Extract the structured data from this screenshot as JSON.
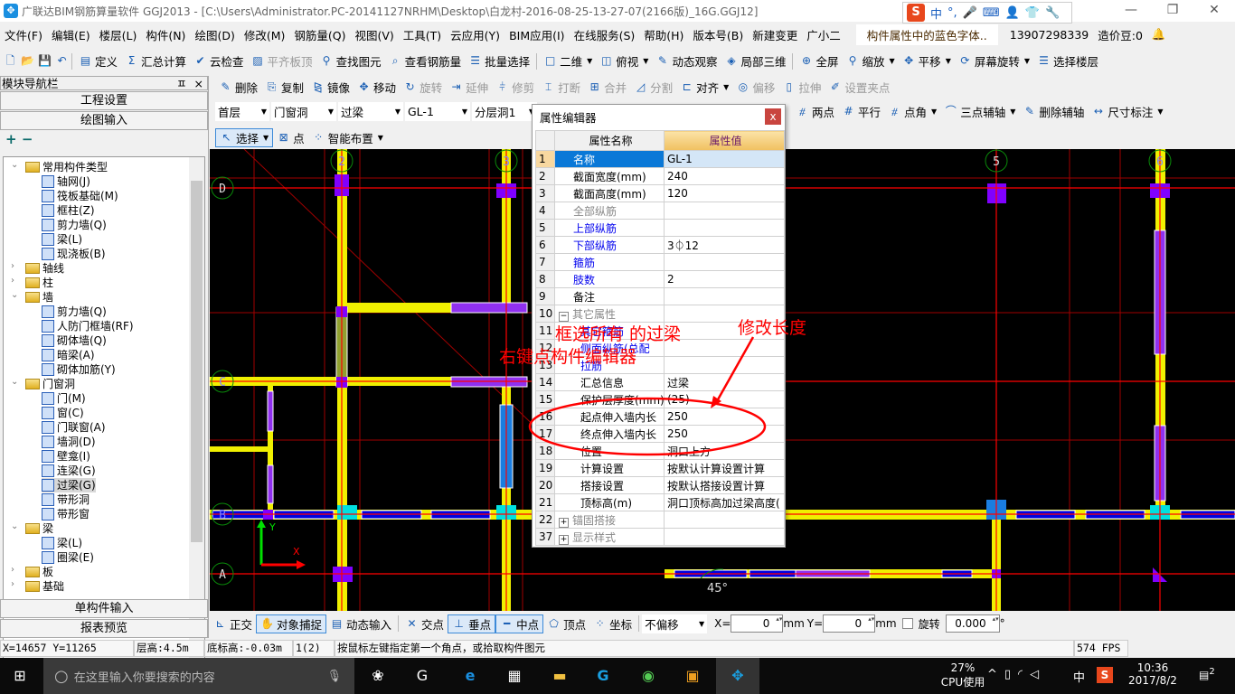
{
  "window": {
    "title": "广联达BIM钢筋算量软件 GGJ2013 - [C:\\Users\\Administrator.PC-20141127NRHM\\Desktop\\白龙村-2016-08-25-13-27-07(2166版)_16G.GGJ12]",
    "minimize": "—",
    "restore": "❐",
    "close": "✕"
  },
  "ime": {
    "items": [
      "S",
      "中",
      "°,",
      "🎤",
      "⌨",
      "👤",
      "👕",
      "🔧"
    ]
  },
  "menubar": {
    "items": [
      "文件(F)",
      "编辑(E)",
      "楼层(L)",
      "构件(N)",
      "绘图(D)",
      "修改(M)",
      "钢筋量(Q)",
      "视图(V)",
      "工具(T)",
      "云应用(Y)",
      "BIM应用(I)",
      "在线服务(S)",
      "帮助(H)",
      "版本号(B)",
      "新建变更",
      "广小二"
    ],
    "notice": "构件属性中的蓝色字体..",
    "account": "13907298339",
    "beans": "造价豆:0"
  },
  "toolbar1": {
    "items": [
      "定义",
      "汇总计算",
      "云检查",
      "平齐板顶",
      "查找图元",
      "查看钢筋量",
      "批量选择",
      "二维",
      "俯视",
      "动态观察",
      "局部三维",
      "全屏",
      "缩放",
      "平移",
      "屏幕旋转",
      "选择楼层"
    ]
  },
  "toolbar2": {
    "items": [
      "删除",
      "复制",
      "镜像",
      "移动",
      "旋转",
      "延伸",
      "修剪",
      "打断",
      "合并",
      "分割",
      "对齐",
      "偏移",
      "拉伸",
      "设置夹点"
    ]
  },
  "selectors": {
    "floor": "首层",
    "category": "门窗洞",
    "type": "过梁",
    "component": "GL-1",
    "layer": "分层洞1"
  },
  "toolbar3": {
    "items": [
      "两点",
      "平行",
      "点角",
      "三点辅轴",
      "删除辅轴",
      "尺寸标注"
    ]
  },
  "toolbar4": {
    "items": [
      "选择",
      "点",
      "智能布置"
    ]
  },
  "sidebar": {
    "title": "模块导航栏",
    "pin": "ㅍ",
    "close": "×",
    "sections": [
      "工程设置",
      "绘图输入",
      "单构件输入",
      "报表预览"
    ],
    "expand_all": "+",
    "collapse_all": "−",
    "tree": [
      {
        "label": "常用构件类型",
        "level": 0,
        "expanded": true
      },
      {
        "label": "轴网(J)",
        "level": 1
      },
      {
        "label": "筏板基础(M)",
        "level": 1
      },
      {
        "label": "框柱(Z)",
        "level": 1
      },
      {
        "label": "剪力墙(Q)",
        "level": 1
      },
      {
        "label": "梁(L)",
        "level": 1
      },
      {
        "label": "现浇板(B)",
        "level": 1
      },
      {
        "label": "轴线",
        "level": 0,
        "expanded": false
      },
      {
        "label": "柱",
        "level": 0,
        "expanded": false
      },
      {
        "label": "墙",
        "level": 0,
        "expanded": true
      },
      {
        "label": "剪力墙(Q)",
        "level": 1
      },
      {
        "label": "人防门框墙(RF)",
        "level": 1
      },
      {
        "label": "砌体墙(Q)",
        "level": 1
      },
      {
        "label": "暗梁(A)",
        "level": 1
      },
      {
        "label": "砌体加筋(Y)",
        "level": 1
      },
      {
        "label": "门窗洞",
        "level": 0,
        "expanded": true
      },
      {
        "label": "门(M)",
        "level": 1
      },
      {
        "label": "窗(C)",
        "level": 1
      },
      {
        "label": "门联窗(A)",
        "level": 1
      },
      {
        "label": "墙洞(D)",
        "level": 1
      },
      {
        "label": "壁龛(I)",
        "level": 1
      },
      {
        "label": "连梁(G)",
        "level": 1
      },
      {
        "label": "过梁(G)",
        "level": 1,
        "selected": true
      },
      {
        "label": "带形洞",
        "level": 1
      },
      {
        "label": "带形窗",
        "level": 1
      },
      {
        "label": "梁",
        "level": 0,
        "expanded": true
      },
      {
        "label": "梁(L)",
        "level": 1
      },
      {
        "label": "圈梁(E)",
        "level": 1
      },
      {
        "label": "板",
        "level": 0,
        "expanded": false
      },
      {
        "label": "基础",
        "level": 0,
        "expanded": false
      }
    ]
  },
  "canvas": {
    "axes_x": [
      "2",
      "3",
      "5",
      "6"
    ],
    "axes_y": [
      "D",
      "C",
      "B",
      "A"
    ],
    "ucs_x": "X",
    "ucs_y": "Y",
    "angle": "45°"
  },
  "property_editor": {
    "title": "属性编辑器",
    "close": "x",
    "col_name": "属性名称",
    "col_value": "属性值",
    "rows": [
      {
        "no": "1",
        "name": "名称",
        "value": "GL-1",
        "style": "sel"
      },
      {
        "no": "2",
        "name": "截面宽度(mm)",
        "value": "240"
      },
      {
        "no": "3",
        "name": "截面高度(mm)",
        "value": "120"
      },
      {
        "no": "4",
        "name": "全部纵筋",
        "value": "",
        "style": "gray"
      },
      {
        "no": "5",
        "name": "上部纵筋",
        "value": "",
        "style": "blue"
      },
      {
        "no": "6",
        "name": "下部纵筋",
        "value": "3⏀12",
        "style": "blue"
      },
      {
        "no": "7",
        "name": "箍筋",
        "value": "",
        "style": "blue"
      },
      {
        "no": "8",
        "name": "肢数",
        "value": "2",
        "style": "blue"
      },
      {
        "no": "9",
        "name": "备注",
        "value": ""
      },
      {
        "no": "10",
        "name": "其它属性",
        "value": "",
        "style": "gray",
        "group": "−"
      },
      {
        "no": "11",
        "name": "其它箍筋",
        "value": "",
        "style": "blue",
        "child": true
      },
      {
        "no": "12",
        "name": "侧面纵筋(总配",
        "value": "",
        "style": "blue",
        "child": true
      },
      {
        "no": "13",
        "name": "拉筋",
        "value": "",
        "style": "blue",
        "child": true
      },
      {
        "no": "14",
        "name": "汇总信息",
        "value": "过梁",
        "child": true
      },
      {
        "no": "15",
        "name": "保护层厚度(mm)",
        "value": "(25)",
        "child": true
      },
      {
        "no": "16",
        "name": "起点伸入墙内长",
        "value": "250",
        "child": true
      },
      {
        "no": "17",
        "name": "终点伸入墙内长",
        "value": "250",
        "child": true
      },
      {
        "no": "18",
        "name": "位置",
        "value": "洞口上方",
        "child": true
      },
      {
        "no": "19",
        "name": "计算设置",
        "value": "按默认计算设置计算",
        "child": true
      },
      {
        "no": "20",
        "name": "搭接设置",
        "value": "按默认搭接设置计算",
        "child": true
      },
      {
        "no": "21",
        "name": "顶标高(m)",
        "value": "洞口顶标高加过梁高度(",
        "child": true
      },
      {
        "no": "22",
        "name": "锚固搭接",
        "value": "",
        "style": "gray",
        "group": "+"
      },
      {
        "no": "37",
        "name": "显示样式",
        "value": "",
        "style": "gray",
        "group": "+"
      }
    ]
  },
  "annotations": {
    "select_all": "框选所有 的过梁",
    "modify_length": "修改长度",
    "right_click": "右键点构件编辑器"
  },
  "bottom_toolbar": {
    "items": [
      "正交",
      "对象捕捉",
      "动态输入",
      "交点",
      "垂点",
      "中点",
      "顶点",
      "坐标"
    ],
    "offset_mode": "不偏移",
    "x_label": "X=",
    "x_value": "0",
    "y_label": "Y=",
    "y_value": "0",
    "unit": "mm",
    "rotate_label": "旋转",
    "rotate_value": "0.000",
    "degree": "°"
  },
  "statusbar": {
    "coords": "X=14657 Y=11265",
    "floor_height": "层高:4.5m",
    "bottom_elev": "底标高:-0.03m",
    "count": "1(2)",
    "hint": "按鼠标左键指定第一个角点，或拾取构件图元",
    "fps": "574 FPS"
  },
  "taskbar": {
    "search_placeholder": "在这里输入你要搜索的内容",
    "cpu_percent": "27%",
    "cpu_label": "CPU使用",
    "ime": "中",
    "time": "10:36",
    "date": "2017/8/2",
    "notifications": "2"
  },
  "colors": {
    "canvas_bg": "#000000",
    "wall": "#f0f000",
    "lintel": "#0000e0",
    "column": "#8000ff",
    "axis_line": "#ff0000",
    "annotation": "#ff0000",
    "selection": "#0a78d7"
  }
}
